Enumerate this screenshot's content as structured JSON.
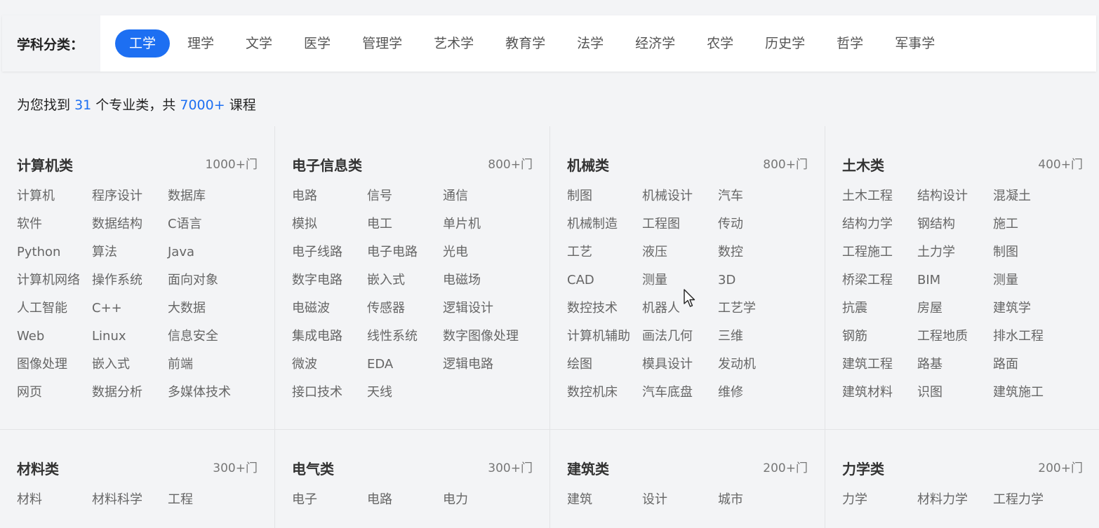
{
  "filter": {
    "label": "学科分类：",
    "tabs": [
      "工学",
      "理学",
      "文学",
      "医学",
      "管理学",
      "艺术学",
      "教育学",
      "法学",
      "经济学",
      "农学",
      "历史学",
      "哲学",
      "军事学"
    ],
    "active_index": 0
  },
  "summary": {
    "prefix": "为您找到",
    "category_count": "31",
    "middle": "个专业类，共",
    "course_count": "7000+",
    "suffix": "课程"
  },
  "categories": [
    {
      "title": "计算机类",
      "count": "1000+门",
      "items": [
        "计算机",
        "程序设计",
        "数据库",
        "软件",
        "数据结构",
        "C语言",
        "Python",
        "算法",
        "Java",
        "计算机网络",
        "操作系统",
        "面向对象",
        "人工智能",
        "C++",
        "大数据",
        "Web",
        "Linux",
        "信息安全",
        "图像处理",
        "嵌入式",
        "前端",
        "网页",
        "数据分析",
        "多媒体技术"
      ]
    },
    {
      "title": "电子信息类",
      "count": "800+门",
      "items": [
        "电路",
        "信号",
        "通信",
        "模拟",
        "电工",
        "单片机",
        "电子线路",
        "电子电路",
        "光电",
        "数字电路",
        "嵌入式",
        "电磁场",
        "电磁波",
        "传感器",
        "逻辑设计",
        "集成电路",
        "线性系统",
        "数字图像处理",
        "微波",
        "EDA",
        "逻辑电路",
        "接口技术",
        "天线"
      ]
    },
    {
      "title": "机械类",
      "count": "800+门",
      "items": [
        "制图",
        "机械设计",
        "汽车",
        "机械制造",
        "工程图",
        "传动",
        "工艺",
        "液压",
        "数控",
        "CAD",
        "测量",
        "3D",
        "数控技术",
        "机器人",
        "工艺学",
        "计算机辅助",
        "画法几何",
        "三维",
        "绘图",
        "模具设计",
        "发动机",
        "数控机床",
        "汽车底盘",
        "维修"
      ]
    },
    {
      "title": "土木类",
      "count": "400+门",
      "items": [
        "土木工程",
        "结构设计",
        "混凝土",
        "结构力学",
        "钢结构",
        "施工",
        "工程施工",
        "土力学",
        "制图",
        "桥梁工程",
        "BIM",
        "测量",
        "抗震",
        "房屋",
        "建筑学",
        "钢筋",
        "工程地质",
        "排水工程",
        "建筑工程",
        "路基",
        "路面",
        "建筑材料",
        "识图",
        "建筑施工"
      ]
    },
    {
      "title": "材料类",
      "count": "300+门",
      "items": [
        "材料",
        "材料科学",
        "工程"
      ]
    },
    {
      "title": "电气类",
      "count": "300+门",
      "items": [
        "电子",
        "电路",
        "电力"
      ]
    },
    {
      "title": "建筑类",
      "count": "200+门",
      "items": [
        "建筑",
        "设计",
        "城市"
      ]
    },
    {
      "title": "力学类",
      "count": "200+门",
      "items": [
        "力学",
        "材料力学",
        "工程力学"
      ]
    }
  ]
}
